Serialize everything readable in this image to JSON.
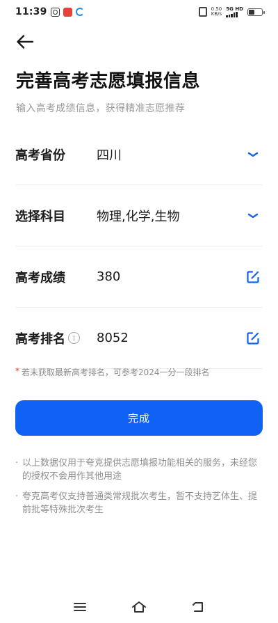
{
  "status_bar": {
    "time": "11:39",
    "network_speed_value": "0.50",
    "network_speed_unit": "KB/s",
    "signal_label": "5G HD"
  },
  "header": {
    "title": "完善高考志愿填报信息",
    "subtitle": "输入高考成绩信息，获得精准志愿推荐"
  },
  "form": {
    "province": {
      "label": "高考省份",
      "value": "四川"
    },
    "subjects": {
      "label": "选择科目",
      "value": "物理,化学,生物"
    },
    "score": {
      "label": "高考成绩",
      "value": "380"
    },
    "rank": {
      "label": "高考排名",
      "value": "8052"
    }
  },
  "hint": {
    "star": "*",
    "text": "若未获取最新高考排名，可参考2024一分一段排名"
  },
  "submit_label": "完成",
  "notes": [
    "以上数据仅用于夸克提供志愿填报功能相关的服务，未经您的授权不会用作其他用途",
    "夸克高考仅支持普通类常规批次考生，暂不支持艺体生、提前批等特殊批次考生"
  ],
  "colors": {
    "primary": "#1062f5",
    "required_star": "#e5362f"
  },
  "icons": {
    "back": "arrow-left-icon",
    "dropdown": "chevron-down-icon",
    "edit": "edit-icon",
    "info": "info-icon"
  }
}
